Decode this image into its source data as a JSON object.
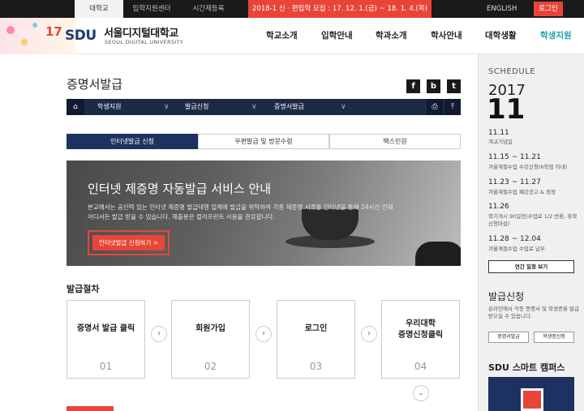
{
  "topbar": {
    "tabs": [
      "대학교",
      "입학지원센터",
      "시간제등록"
    ],
    "notice": "2018-1 신 · 편입학 모집 : 17. 12. 1.(금) ~ 18. 1. 4.(목)",
    "english": "ENGLISH",
    "login": "로그인"
  },
  "header": {
    "logo_num": "17",
    "logo_sdu": "SDU",
    "logo_kr": "서울디지털대학교",
    "logo_en": "SEOUL DIGITAL UNIVERSITY",
    "nav": [
      "학교소개",
      "입학안내",
      "학과소개",
      "학사안내",
      "대학생활",
      "학생지원"
    ]
  },
  "page": {
    "title": "증명서발급",
    "sns": [
      "f",
      "b",
      "t"
    ]
  },
  "breadcrumb": {
    "home": "⌂",
    "items": [
      "학생지원",
      "발급신청",
      "증명서발급"
    ],
    "print": "⎙",
    "top": "⤒"
  },
  "subtabs": [
    "인터넷발급 신청",
    "우편발급 및 방문수령",
    "팩스민원"
  ],
  "banner": {
    "title": "인터넷 제증명 자동발급 서비스 안내",
    "desc": "본교에서는 공신력 있는 인터넷 제증명 발급대행 업체에 발급을 위탁하여 각종 제증명 서류를 인터넷을 통해 24시간 언제 어디서든 발급 받을 수 있습니다. 제출용은 컬러프린트 사용을 권유합니다.",
    "button": "인터넷발급 신청하기 >"
  },
  "process": {
    "title": "발급절차",
    "steps": [
      {
        "label": "증명서 발급 클릭",
        "num": "01"
      },
      {
        "label": "회원가입",
        "num": "02"
      },
      {
        "label": "로그인",
        "num": "03"
      },
      {
        "label": "우리대학\n증명신청클릭",
        "num": "04"
      }
    ],
    "arrow": "›",
    "down": "⌄"
  },
  "sidebar": {
    "schedule_label": "SCHEDULE",
    "year": "2017",
    "month": "11",
    "events": [
      {
        "date": "11.11",
        "desc": "개교기념일"
      },
      {
        "date": "11.15 ~ 11.21",
        "desc": "겨울계절수업 수강신청(6학점 이내)"
      },
      {
        "date": "11.23 ~ 11.27",
        "desc": "겨울계절수업 폐강공고 & 정정"
      },
      {
        "date": "11.26",
        "desc": "학기개시 90일전(수업료 1/2 반환, 휴학신청마감)"
      },
      {
        "date": "11.28 ~ 12.04",
        "desc": "겨울계절수업 수업료 납부"
      }
    ],
    "yearly_btn": "연간 일정 보기",
    "apply_title": "발급신청",
    "apply_desc": "온라인에서 각종 증명서 및 학생증을 발급받으실 수 있습니다.",
    "apply_btns": [
      "증명서발급",
      "학생증신청"
    ],
    "smart_title": "SDU 스마트 캠퍼스"
  }
}
